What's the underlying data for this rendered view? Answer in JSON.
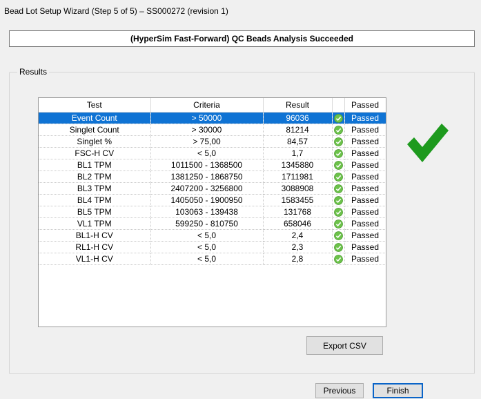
{
  "window": {
    "title": "Bead Lot Setup Wizard (Step 5 of 5) – SS000272 (revision 1)"
  },
  "banner": {
    "text": "(HyperSim Fast-Forward) QC Beads Analysis Succeeded"
  },
  "results": {
    "label": "Results",
    "columns": {
      "test": "Test",
      "criteria": "Criteria",
      "result": "Result",
      "status_icon": "",
      "passed": "Passed"
    },
    "rows": [
      {
        "test": "Event Count",
        "criteria": "> 50000",
        "result": "96036",
        "passed": "Passed",
        "selected": true
      },
      {
        "test": "Singlet Count",
        "criteria": "> 30000",
        "result": "81214",
        "passed": "Passed"
      },
      {
        "test": "Singlet %",
        "criteria": "> 75,00",
        "result": "84,57",
        "passed": "Passed"
      },
      {
        "test": "FSC-H CV",
        "criteria": "< 5,0",
        "result": "1,7",
        "passed": "Passed"
      },
      {
        "test": "BL1 TPM",
        "criteria": "1011500 - 1368500",
        "result": "1345880",
        "passed": "Passed"
      },
      {
        "test": "BL2 TPM",
        "criteria": "1381250 - 1868750",
        "result": "1711981",
        "passed": "Passed"
      },
      {
        "test": "BL3 TPM",
        "criteria": "2407200 - 3256800",
        "result": "3088908",
        "passed": "Passed"
      },
      {
        "test": "BL4 TPM",
        "criteria": "1405050 - 1900950",
        "result": "1583455",
        "passed": "Passed"
      },
      {
        "test": "BL5 TPM",
        "criteria": "103063 - 139438",
        "result": "131768",
        "passed": "Passed"
      },
      {
        "test": "VL1 TPM",
        "criteria": "599250 - 810750",
        "result": "658046",
        "passed": "Passed"
      },
      {
        "test": "BL1-H CV",
        "criteria": "< 5,0",
        "result": "2,4",
        "passed": "Passed"
      },
      {
        "test": "RL1-H CV",
        "criteria": "< 5,0",
        "result": "2,3",
        "passed": "Passed"
      },
      {
        "test": "VL1-H CV",
        "criteria": "< 5,0",
        "result": "2,8",
        "passed": "Passed"
      }
    ]
  },
  "icons": {
    "row_status": "check-circle-icon",
    "overall_status": "big-checkmark-icon"
  },
  "colors": {
    "selection": "#0f73d4",
    "pass_green": "#1e9a1e",
    "row_check_green": "#6cc24a"
  },
  "buttons": {
    "export_csv": "Export CSV",
    "previous": "Previous",
    "finish": "Finish"
  }
}
